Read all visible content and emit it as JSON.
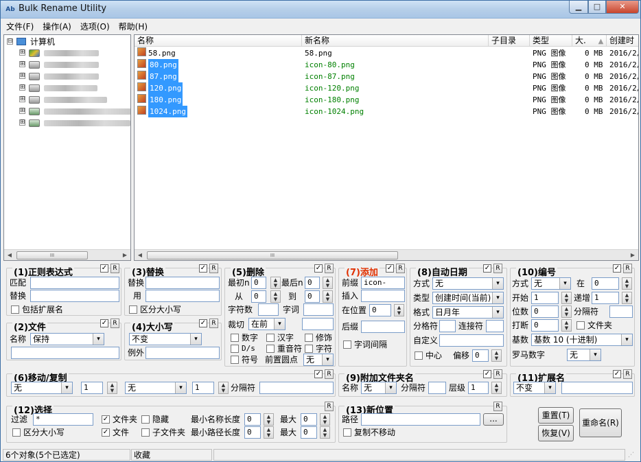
{
  "title": "Bulk Rename Utility",
  "window_buttons": {
    "min": "▁",
    "max": "□",
    "close": "✕"
  },
  "menu": [
    "文件(F)",
    "操作(A)",
    "选项(O)",
    "帮助(H)"
  ],
  "tree": {
    "root": "计算机",
    "expand_root": "⊟",
    "expand": "⊞"
  },
  "scroll": {
    "thumb": "III"
  },
  "columns": [
    "名称",
    "新名称",
    "子目录",
    "类型",
    "大.",
    "创建时"
  ],
  "files": [
    {
      "name": "58.png",
      "new": "58.png",
      "type": "PNG 图像",
      "size": "0 MB",
      "created": "2016/2/",
      "selected": false
    },
    {
      "name": "80.png",
      "new": "icon-80.png",
      "type": "PNG 图像",
      "size": "0 MB",
      "created": "2016/2/",
      "selected": true
    },
    {
      "name": "87.png",
      "new": "icon-87.png",
      "type": "PNG 图像",
      "size": "0 MB",
      "created": "2016/2/",
      "selected": true
    },
    {
      "name": "120.png",
      "new": "icon-120.png",
      "type": "PNG 图像",
      "size": "0 MB",
      "created": "2016/2/",
      "selected": true
    },
    {
      "name": "180.png",
      "new": "icon-180.png",
      "type": "PNG 图像",
      "size": "0 MB",
      "created": "2016/2/",
      "selected": true
    },
    {
      "name": "1024.png",
      "new": "icon-1024.png",
      "type": "PNG 图像",
      "size": "0 MB",
      "created": "2016/2/",
      "selected": true
    }
  ],
  "sort_indicator": "▲",
  "g1": {
    "title": "(1)正则表达式",
    "r": "R",
    "match": "匹配",
    "replace": "替换",
    "include_ext": "包括扩展名"
  },
  "g2": {
    "title": "(2)文件",
    "r": "R",
    "name_lbl": "名称",
    "name_val": "保持"
  },
  "g3": {
    "title": "(3)替换",
    "r": "R",
    "replace": "替换",
    "with": "用",
    "case": "区分大小写"
  },
  "g4": {
    "title": "(4)大小写",
    "r": "R",
    "mode": "不变",
    "except": "例外"
  },
  "g5": {
    "title": "(5)删除",
    "r": "R",
    "first_n": "最初n",
    "first_v": "0",
    "last_n": "最后n",
    "last_v": "0",
    "from": "从",
    "from_v": "0",
    "to": "到",
    "to_v": "0",
    "chars": "字符数",
    "words": "字词",
    "crop": "裁切",
    "crop_v": "在前",
    "digits": "数字",
    "hanzi": "汉字",
    "trim": "修饰",
    "ds": "D/s",
    "accents": "重音符",
    "chars2": "字符",
    "symbols": "符号",
    "lead_dots": "前置圆点",
    "lead_v": "无"
  },
  "g7": {
    "title": "(7)添加",
    "r": "R",
    "prefix": "前缀",
    "prefix_v": "icon-",
    "insert": "插入",
    "at_pos": "在位置",
    "at_v": "0",
    "suffix": "后缀",
    "word_space": "字词间隔"
  },
  "g8": {
    "title": "(8)自动日期",
    "r": "R",
    "mode": "方式",
    "mode_v": "无",
    "type": "类型",
    "type_v": "创建时间(当前)",
    "format": "格式",
    "format_v": "日月年",
    "sep": "分格符",
    "join": "连接符",
    "custom": "自定义",
    "center": "中心",
    "offset": "偏移",
    "offset_v": "0"
  },
  "g10": {
    "title": "(10)编号",
    "r": "R",
    "mode": "方式",
    "mode_v": "无",
    "at": "在",
    "at_v": "0",
    "start": "开始",
    "start_v": "1",
    "incr": "递增",
    "incr_v": "1",
    "pad": "位数",
    "pad_v": "0",
    "sep": "分隔符",
    "break": "打断",
    "break_v": "0",
    "folder": "文件夹",
    "base": "基数",
    "base_v": "基数 10 (十进制)",
    "roman": "罗马数字",
    "roman_v": "无"
  },
  "g6": {
    "title": "(6)移动/复制",
    "r": "R",
    "mode_v": "无",
    "n1": "1",
    "mode2_v": "无",
    "n2": "1",
    "sep": "分隔符"
  },
  "g9": {
    "title": "(9)附加文件夹名",
    "r": "R",
    "name": "名称",
    "name_v": "无",
    "sep": "分隔符",
    "level": "层级",
    "level_v": "1"
  },
  "g11": {
    "title": "(11)扩展名",
    "r": "R",
    "mode_v": "不变"
  },
  "g12": {
    "title": "(12)选择",
    "r": "R",
    "filter": "过滤",
    "filter_v": "*",
    "folders": "文件夹",
    "hidden": "隐藏",
    "min_name": "最小名称长度",
    "min_name_v": "0",
    "max": "最大",
    "max_v": "0",
    "case": "区分大小写",
    "files": "文件",
    "subfolders": "子文件夹",
    "min_path": "最小路径长度",
    "min_path_v": "0",
    "max2_v": "0"
  },
  "g13": {
    "title": "(13)新位置",
    "r": "R",
    "path": "路径",
    "browse": "...",
    "copy_not_move": "复制不移动"
  },
  "buttons": {
    "reset": "重置(T)",
    "revert": "恢复(V)",
    "rename": "重命名(R)"
  },
  "status": {
    "count": "6个对象(5个已选定)",
    "fav": "收藏"
  }
}
